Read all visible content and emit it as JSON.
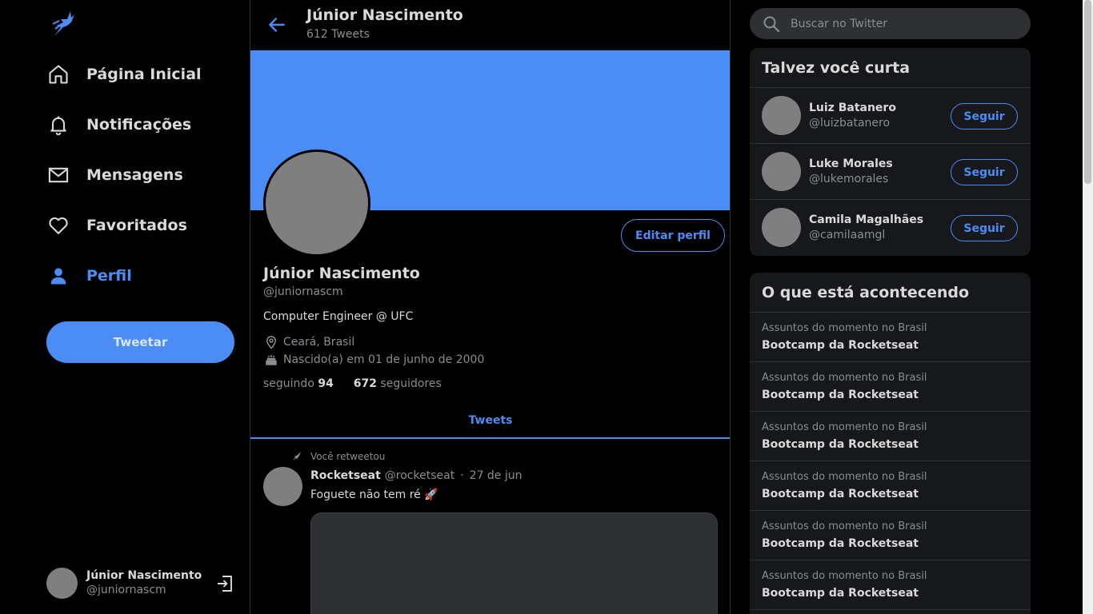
{
  "sidebar": {
    "logo_icon": "bird-icon",
    "nav": [
      {
        "label": "Página Inicial",
        "icon": "home-icon"
      },
      {
        "label": "Notificações",
        "icon": "bell-icon"
      },
      {
        "label": "Mensagens",
        "icon": "mail-icon"
      },
      {
        "label": "Favoritados",
        "icon": "heart-icon"
      },
      {
        "label": "Perfil",
        "icon": "person-icon",
        "active": true
      }
    ],
    "tweet_button": "Tweetar",
    "account": {
      "name": "Júnior Nascimento",
      "handle": "@juniornascm",
      "logout_icon": "logout-icon"
    }
  },
  "header": {
    "title": "Júnior Nascimento",
    "tweet_count": "612 Tweets"
  },
  "profile": {
    "edit_button": "Editar perfil",
    "name": "Júnior Nascimento",
    "handle": "@juniornascm",
    "bio": "Computer Engineer @ UFC",
    "location": "Ceará, Brasil",
    "birthday": "Nascido(a) em 01 de junho de 2000",
    "following_label": "seguindo",
    "following_count": "94",
    "followers_count": "672",
    "followers_label": "seguidores",
    "banner_color": "#4c8cf5"
  },
  "tabs": {
    "tweets": "Tweets"
  },
  "tweet": {
    "retweet_note": "Você retweetou",
    "author": "Rocketseat",
    "handle": "@rocketseat",
    "separator": "·",
    "date": "27 de jun",
    "text": "Foguete não tem ré 🚀"
  },
  "search": {
    "placeholder": "Buscar no Twitter"
  },
  "who_to_follow": {
    "title": "Talvez você curta",
    "button": "Seguir",
    "users": [
      {
        "name": "Luiz Batanero",
        "handle": "@luizbatanero"
      },
      {
        "name": "Luke Morales",
        "handle": "@lukemorales"
      },
      {
        "name": "Camila Magalhães",
        "handle": "@camilaamgl"
      }
    ]
  },
  "trends": {
    "title": "O que está acontecendo",
    "items": [
      {
        "context": "Assuntos do momento no Brasil",
        "title": "Bootcamp da Rocketseat"
      },
      {
        "context": "Assuntos do momento no Brasil",
        "title": "Bootcamp da Rocketseat"
      },
      {
        "context": "Assuntos do momento no Brasil",
        "title": "Bootcamp da Rocketseat"
      },
      {
        "context": "Assuntos do momento no Brasil",
        "title": "Bootcamp da Rocketseat"
      },
      {
        "context": "Assuntos do momento no Brasil",
        "title": "Bootcamp da Rocketseat"
      },
      {
        "context": "Assuntos do momento no Brasil",
        "title": "Bootcamp da Rocketseat"
      }
    ]
  },
  "colors": {
    "accent": "#4c8cf5",
    "background": "#000000",
    "card": "#17181b"
  }
}
